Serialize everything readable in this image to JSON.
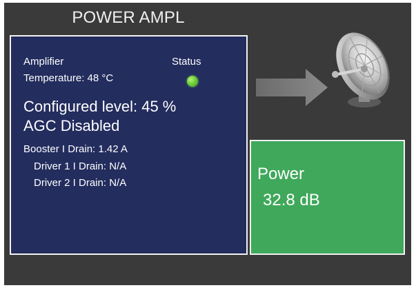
{
  "header": {
    "title": "POWER AMPL"
  },
  "amplifier": {
    "heading": "Amplifier",
    "status_label": "Status",
    "status_color": "#6fcf3a",
    "temperature": "Temperature: 48 °C",
    "configured_level": "Configured level: 45 %",
    "agc": "AGC Disabled",
    "booster_drain": "Booster I Drain: 1.42 A",
    "driver1_drain": "Driver 1 I Drain: N/A",
    "driver2_drain": "Driver 2 I Drain: N/A"
  },
  "icons": {
    "arrow": "arrow-right-icon",
    "dish": "satellite-dish-icon"
  },
  "power": {
    "label": "Power",
    "value": "32.8 dB",
    "background": "#3fa85a"
  },
  "colors": {
    "screen_bg": "#3a3a3a",
    "panel_bg": "#232d5e",
    "border": "#f2f2f2"
  }
}
